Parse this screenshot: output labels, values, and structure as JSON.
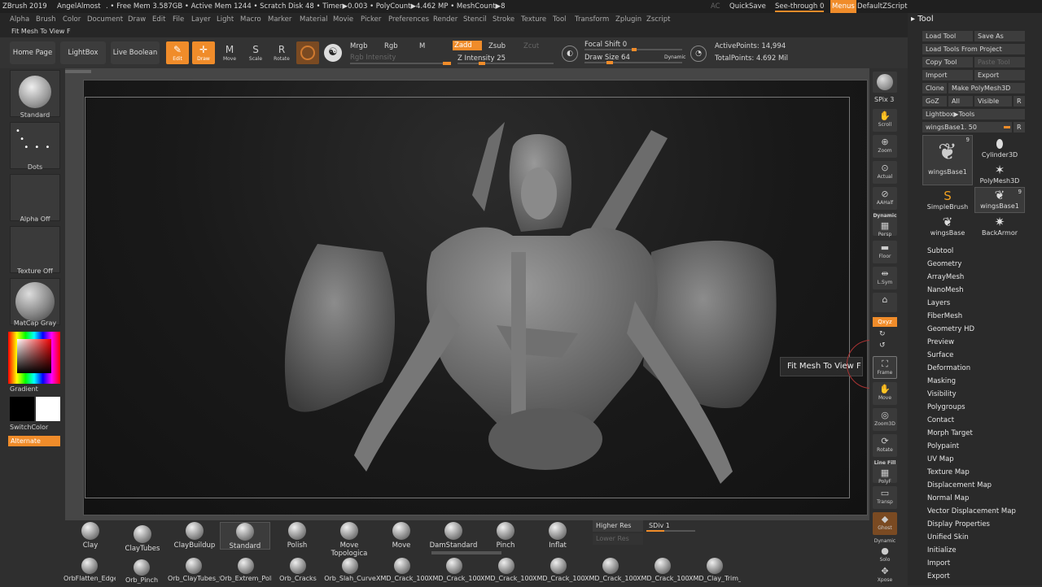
{
  "title_bar": {
    "app": "ZBrush 2019",
    "user": "AngelAlmost",
    "status": ". • Free Mem 3.587GB • Active Mem 1244 • Scratch Disk 48 • Timer▶0.003 • PolyCount▶4.462 MP • MeshCount▶8",
    "ac": "AC",
    "quicksave": "QuickSave",
    "seethrough": "See-through  0",
    "menus": "Menus",
    "script": "DefaultZScript"
  },
  "menu": [
    "Alpha",
    "Brush",
    "Color",
    "Document",
    "Draw",
    "Edit",
    "File",
    "Layer",
    "Light",
    "Macro",
    "Marker",
    "Material",
    "Movie",
    "Picker",
    "Preferences",
    "Render",
    "Stencil",
    "Stroke",
    "Texture",
    "Tool",
    "Transform",
    "Zplugin",
    "Zscript"
  ],
  "hint": "Fit Mesh To View F",
  "toolbar": {
    "home": "Home Page",
    "lightbox": "LightBox",
    "liveboolean": "Live Boolean",
    "edit": "Edit",
    "draw": "Draw",
    "move": "Move",
    "scale": "Scale",
    "rotate": "Rotate",
    "mrgb": "Mrgb",
    "rgb": "Rgb",
    "m": "M",
    "zadd": "Zadd",
    "zsub": "Zsub",
    "zcut": "Zcut",
    "rgb_intensity": "Rgb Intensity",
    "z_intensity": "Z Intensity 25",
    "focal_shift": "Focal Shift 0",
    "draw_size": "Draw Size 64",
    "dynamic": "Dynamic",
    "active_points": "ActivePoints: 14,994",
    "total_points": "TotalPoints: 4.692 Mil",
    "z_intensity_level": 25,
    "draw_size_level": 64
  },
  "left": {
    "standard": "Standard",
    "dots": "Dots",
    "alpha_off": "Alpha Off",
    "texture_off": "Texture Off",
    "matcap": "MatCap Gray",
    "gradient": "Gradient",
    "switchcolor": "SwitchColor",
    "alternate": "Alternate"
  },
  "right": {
    "bpr": "BPR",
    "spix": "SPix 3",
    "scroll": "Scroll",
    "zoom": "Zoom",
    "actual": "Actual",
    "aahalf": "AAHalf",
    "dynamic": "Dynamic",
    "persp": "Persp",
    "floor": "Floor",
    "lsym": "L.Sym",
    "xyz": "Qxyz",
    "frame": "Frame",
    "move": "Move",
    "zoom3d": "Zoom3D",
    "rotate": "Rotate",
    "linefill": "Line Fill",
    "polyf": "PolyF",
    "transp": "Transp",
    "ghost": "Ghost",
    "solo": "Solo",
    "xpose": "Xpose"
  },
  "tooltip": "Fit Mesh To View  F",
  "tool": {
    "title": "Tool",
    "load_tool": "Load Tool",
    "save_as": "Save As",
    "load_from_project": "Load Tools From Project",
    "copy_tool": "Copy Tool",
    "paste_tool": "Paste Tool",
    "import": "Import",
    "export": "Export",
    "clone": "Clone",
    "make_polymesh": "Make PolyMesh3D",
    "goz": "GoZ",
    "all": "All",
    "visible": "Visible",
    "r": "R",
    "lightbox_tools": "Lightbox▶Tools",
    "current": "wingsBase1. 50",
    "thumbs": [
      {
        "name": "wingsBase1",
        "badge": "9"
      },
      {
        "name": "Cylinder3D"
      },
      {
        "name": "PolyMesh3D"
      },
      {
        "name": "SimpleBrush"
      },
      {
        "name": "wingsBase1",
        "badge": "9"
      },
      {
        "name": "wingsBase"
      },
      {
        "name": "BackArmor"
      }
    ],
    "items": [
      "Subtool",
      "Geometry",
      "ArrayMesh",
      "NanoMesh",
      "Layers",
      "FiberMesh",
      "Geometry HD",
      "Preview",
      "Surface",
      "Deformation",
      "Masking",
      "Visibility",
      "Polygroups",
      "Contact",
      "Morph Target",
      "Polypaint",
      "UV Map",
      "Texture Map",
      "Displacement Map",
      "Normal Map",
      "Vector Displacement Map",
      "Display Properties",
      "Unified Skin",
      "Initialize",
      "Import",
      "Export"
    ]
  },
  "brushes": [
    "Clay",
    "ClayTubes",
    "ClayBuildup",
    "Standard",
    "Polish",
    "Move Topologica",
    "Move",
    "DamStandard",
    "Pinch",
    "Inflat"
  ],
  "higher_res": "Higher Res",
  "lower_res": "Lower Res",
  "sdiv": "SDiv 1",
  "brushes2": [
    "OrbFlatten_Edge",
    "Orb_Pinch",
    "Orb_ClayTubes_S",
    "Orb_Extrem_Poli",
    "Orb_Cracks",
    "Orb_Slah_Curve",
    "XMD_Crack_100",
    "XMD_Crack_100",
    "XMD_Crack_100",
    "XMD_Crack_100",
    "XMD_Crack_100",
    "XMD_Crack_100",
    "XMD_Clay_Trim_"
  ],
  "colors": {
    "accent": "#f08c2a"
  }
}
